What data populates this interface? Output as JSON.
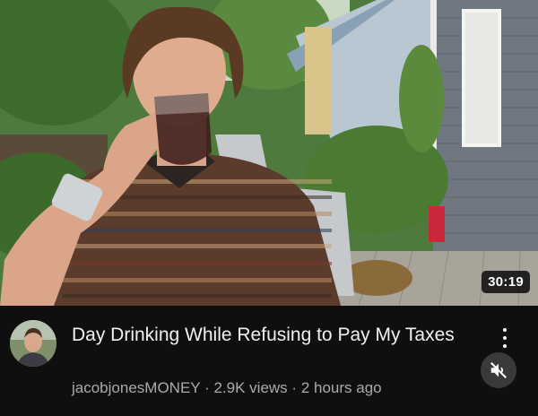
{
  "video": {
    "title": "Day Drinking While Refusing to Pay My Taxes",
    "channel": "jacobjonesMONEY",
    "views": "2.9K views",
    "age": "2 hours ago",
    "separator": "·",
    "duration": "30:19"
  },
  "icons": {
    "menu": "more-vert-icon",
    "mute": "volume-off-icon"
  },
  "colors": {
    "background": "#0f0f0f",
    "title_text": "#f1f1f1",
    "secondary_text": "#aaaaaa",
    "duration_badge": "#000000"
  }
}
